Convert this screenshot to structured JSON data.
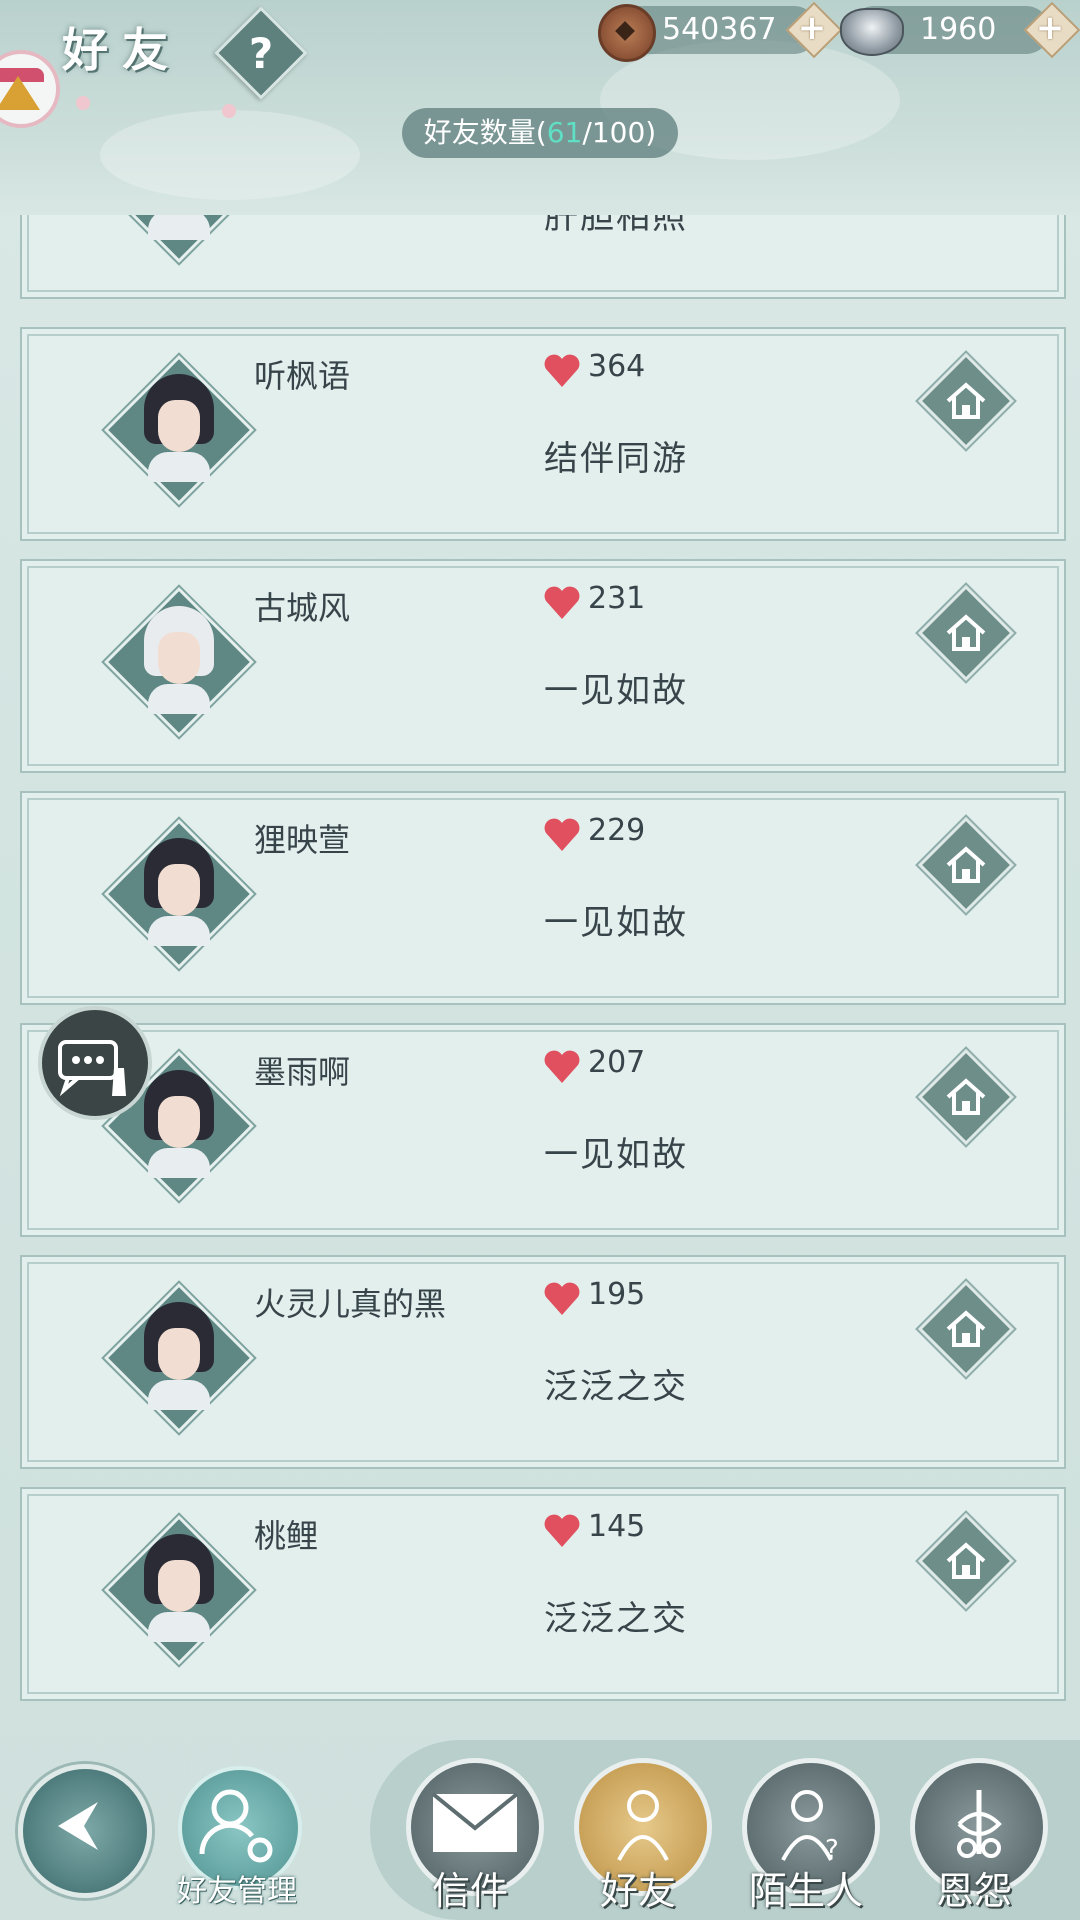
{
  "header": {
    "title": "好友",
    "help_label": "?",
    "copper_amount": "540367",
    "silver_amount": "1960",
    "friend_count_label": "好友数量",
    "friend_count_current": "61",
    "friend_count_max": "100",
    "colors": {
      "header_bg": "#b9d1cd",
      "accent_count": "#5fe0c4"
    }
  },
  "friends": [
    {
      "name": "",
      "score": "",
      "relation": "肝胆相照"
    },
    {
      "name": "听枫语",
      "score": "364",
      "relation": "结伴同游"
    },
    {
      "name": "古城风",
      "score": "231",
      "relation": "一见如故"
    },
    {
      "name": "狸映萱",
      "score": "229",
      "relation": "一见如故"
    },
    {
      "name": "墨雨啊",
      "score": "207",
      "relation": "一见如故"
    },
    {
      "name": "火灵儿真的黑",
      "score": "195",
      "relation": "泛泛之交"
    },
    {
      "name": "桃鲤",
      "score": "145",
      "relation": "泛泛之交"
    }
  ],
  "icons": {
    "heart": "heart-icon",
    "home": "home-icon",
    "chat": "chat-bubble-icon"
  },
  "bottom_nav": {
    "manage_label": "好友管理",
    "tabs": [
      {
        "label": "信件",
        "icon": "envelope-icon"
      },
      {
        "label": "好友",
        "icon": "friend-icon",
        "active": true
      },
      {
        "label": "陌生人",
        "icon": "stranger-icon"
      },
      {
        "label": "恩怨",
        "icon": "feud-icon"
      }
    ]
  }
}
